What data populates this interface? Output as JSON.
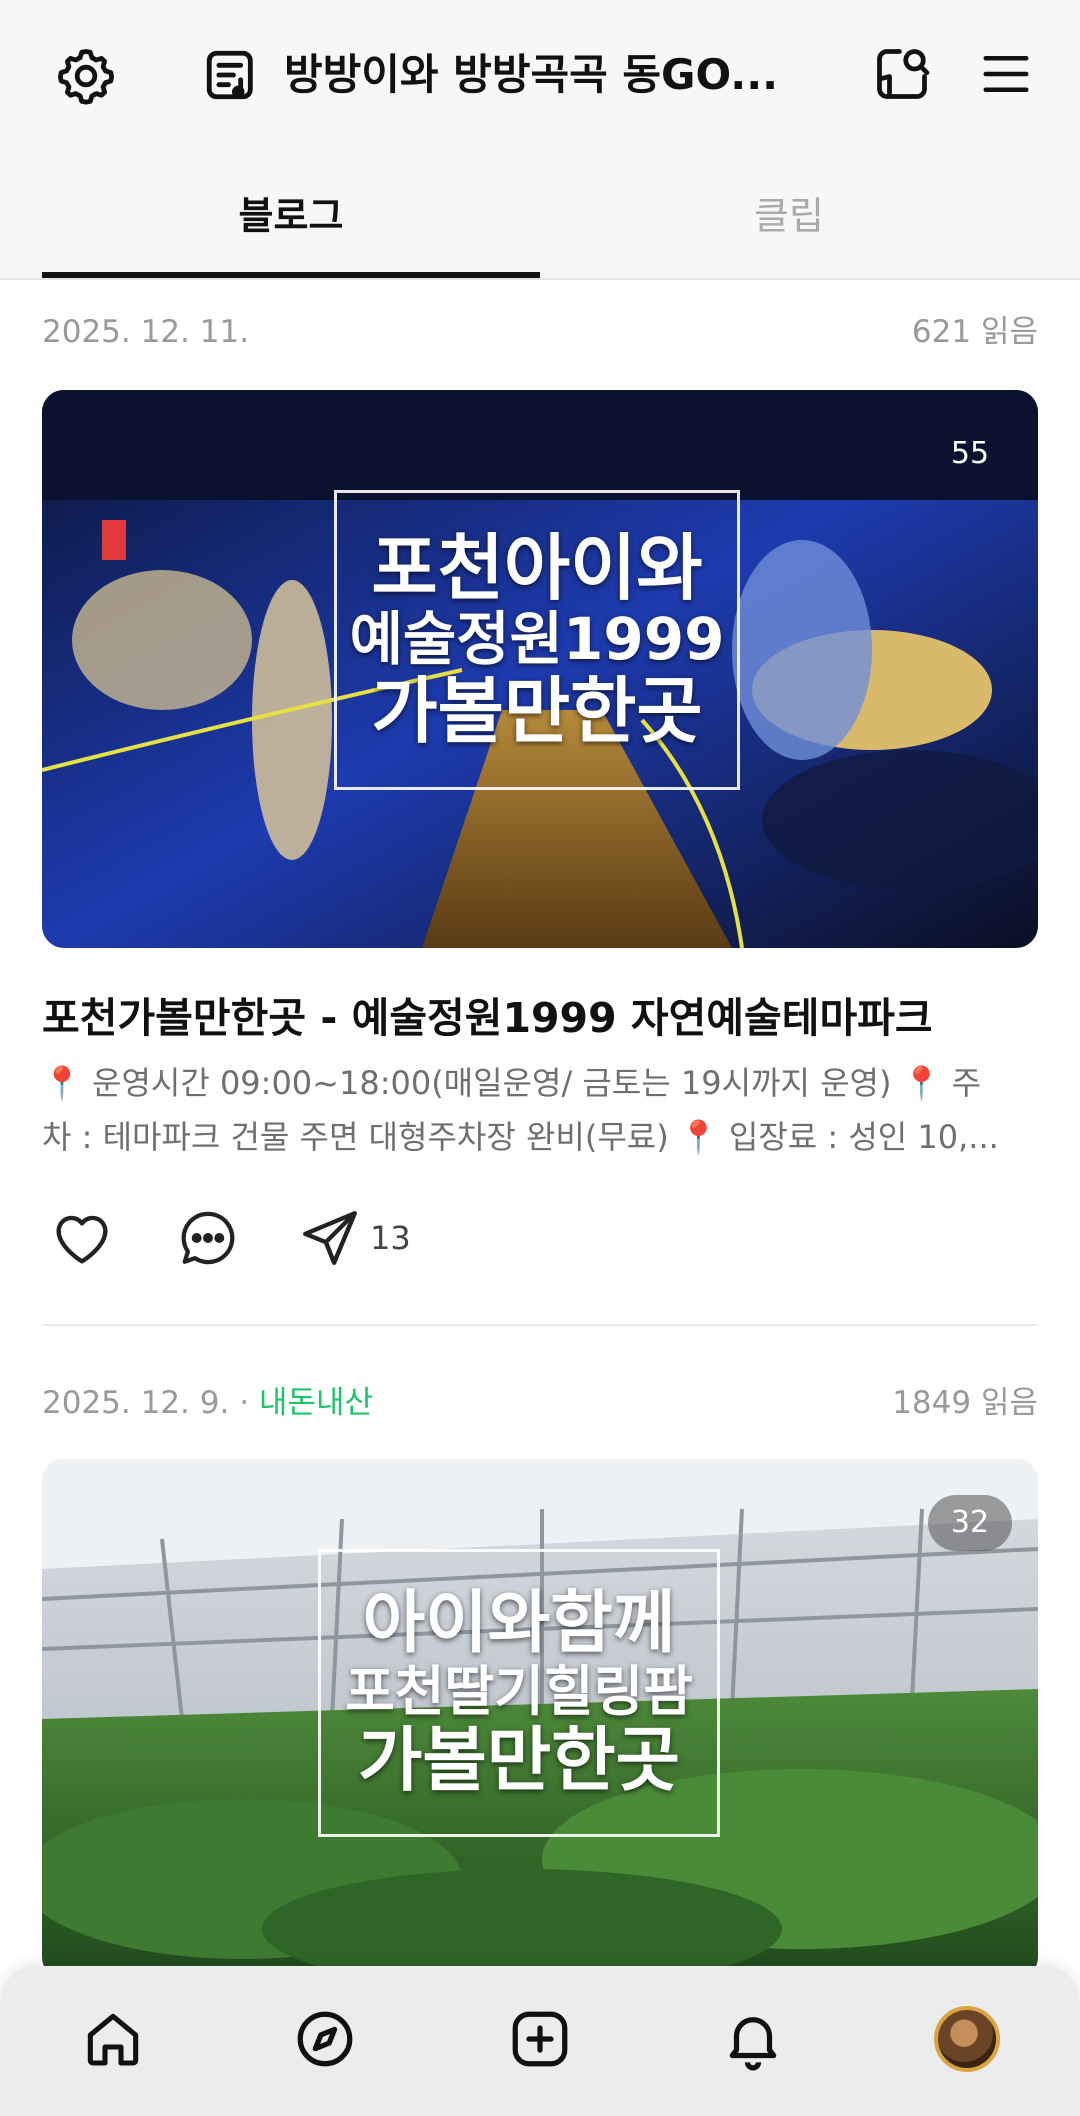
{
  "header": {
    "blog_title": "방방이와 방방곡곡 동GO...",
    "icons": [
      "gear-icon",
      "blog-document-icon",
      "search-icon",
      "menu-icon"
    ]
  },
  "tabs": [
    {
      "label": "블로그",
      "active": true
    },
    {
      "label": "클립",
      "active": false
    }
  ],
  "posts": [
    {
      "date": "2025. 12. 11.",
      "category": "",
      "reads": "621 읽음",
      "image_count": "55",
      "image_overlay": [
        "포천아이와",
        "예술정원1999",
        "가볼만한곳"
      ],
      "title": "포천가볼만한곳 - 예술정원1999 자연예술테마파크",
      "excerpt_lines": [
        "📍 운영시간 09:00~18:00(매일운영/ 금토는 19시까지 운영) 📍 주",
        "차 : 테마파크 건물 주면 대형주차장 완비(무료) 📍 입장료 : 성인 10,..."
      ],
      "share_count": "13"
    },
    {
      "date": "2025. 12. 9.",
      "separator": " · ",
      "category": "내돈내산",
      "reads": "1849 읽음",
      "image_count": "32",
      "image_overlay": [
        "아이와함께",
        "포천딸기힐링팜",
        "가볼만한곳"
      ]
    }
  ],
  "bottom_nav": [
    "home-icon",
    "compass-icon",
    "add-post-icon",
    "bell-icon",
    "profile-avatar"
  ],
  "colors": {
    "accent_green": "#1ec46a",
    "active_tab": "#111111",
    "inactive_tab": "#aaaaaa"
  }
}
